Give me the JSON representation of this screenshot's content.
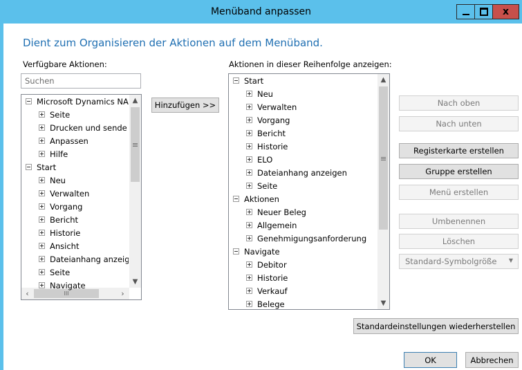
{
  "window": {
    "title": "Menüband anpassen"
  },
  "heading": "Dient zum Organisieren der Aktionen auf dem Menüband.",
  "left": {
    "label": "Verfügbare Aktionen:",
    "search_placeholder": "Suchen",
    "tree": [
      {
        "label": "Microsoft Dynamics NA",
        "level": 0,
        "expanded": true
      },
      {
        "label": "Seite",
        "level": 1
      },
      {
        "label": "Drucken und sende",
        "level": 1
      },
      {
        "label": "Anpassen",
        "level": 1
      },
      {
        "label": "Hilfe",
        "level": 1
      },
      {
        "label": "Start",
        "level": 0,
        "expanded": true
      },
      {
        "label": "Neu",
        "level": 1
      },
      {
        "label": "Verwalten",
        "level": 1
      },
      {
        "label": "Vorgang",
        "level": 1
      },
      {
        "label": "Bericht",
        "level": 1
      },
      {
        "label": "Historie",
        "level": 1
      },
      {
        "label": "Ansicht",
        "level": 1
      },
      {
        "label": "Dateianhang anzeig",
        "level": 1
      },
      {
        "label": "Seite",
        "level": 1
      },
      {
        "label": "Navigate",
        "level": 1
      }
    ]
  },
  "add_button": "Hinzufügen >>",
  "right": {
    "label": "Aktionen in dieser Reihenfolge anzeigen:",
    "tree": [
      {
        "label": "Start",
        "level": 0,
        "expanded": true
      },
      {
        "label": "Neu",
        "level": 1
      },
      {
        "label": "Verwalten",
        "level": 1
      },
      {
        "label": "Vorgang",
        "level": 1
      },
      {
        "label": "Bericht",
        "level": 1
      },
      {
        "label": "Historie",
        "level": 1
      },
      {
        "label": "ELO",
        "level": 1
      },
      {
        "label": "Dateianhang anzeigen",
        "level": 1
      },
      {
        "label": "Seite",
        "level": 1
      },
      {
        "label": "Aktionen",
        "level": 0,
        "expanded": true
      },
      {
        "label": "Neuer Beleg",
        "level": 1
      },
      {
        "label": "Allgemein",
        "level": 1
      },
      {
        "label": "Genehmigungsanforderung",
        "level": 1
      },
      {
        "label": "Navigate",
        "level": 0,
        "expanded": true
      },
      {
        "label": "Debitor",
        "level": 1
      },
      {
        "label": "Historie",
        "level": 1
      },
      {
        "label": "Verkauf",
        "level": 1
      },
      {
        "label": "Belege",
        "level": 1
      }
    ]
  },
  "side_buttons": {
    "move_up": "Nach oben",
    "move_down": "Nach unten",
    "create_tab": "Registerkarte erstellen",
    "create_group": "Gruppe erstellen",
    "create_menu": "Menü erstellen",
    "rename": "Umbenennen",
    "delete": "Löschen",
    "icon_size": "Standard-Symbolgröße"
  },
  "reset_button": "Standardeinstellungen wiederherstellen",
  "ok_button": "OK",
  "cancel_button": "Abbrechen"
}
